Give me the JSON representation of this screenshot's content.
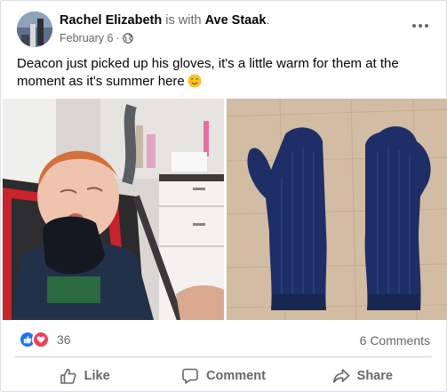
{
  "post": {
    "author": "Rachel Elizabeth",
    "with_text": "is with",
    "tagged": "Ave Staak",
    "period": ".",
    "date": "February 6",
    "date_sep": "·",
    "privacy_icon": "globe-icon",
    "text": "Deacon just picked up his gloves, it's a little warm for them at the moment as it's summer here",
    "emoji": "smiling-face-emoji"
  },
  "photos": [
    {
      "name": "child-in-stroller-photo",
      "icon": "photo"
    },
    {
      "name": "knitted-mittens-photo",
      "icon": "photo"
    }
  ],
  "reactions": {
    "types": [
      "like",
      "love"
    ],
    "count": "36",
    "comments": "6 Comments"
  },
  "actions": {
    "like": "Like",
    "comment": "Comment",
    "share": "Share"
  },
  "colors": {
    "brand": "#1877f2",
    "love": "#f33e58",
    "muted_text": "#65676b",
    "mitten_blue": "#1d2f66"
  }
}
